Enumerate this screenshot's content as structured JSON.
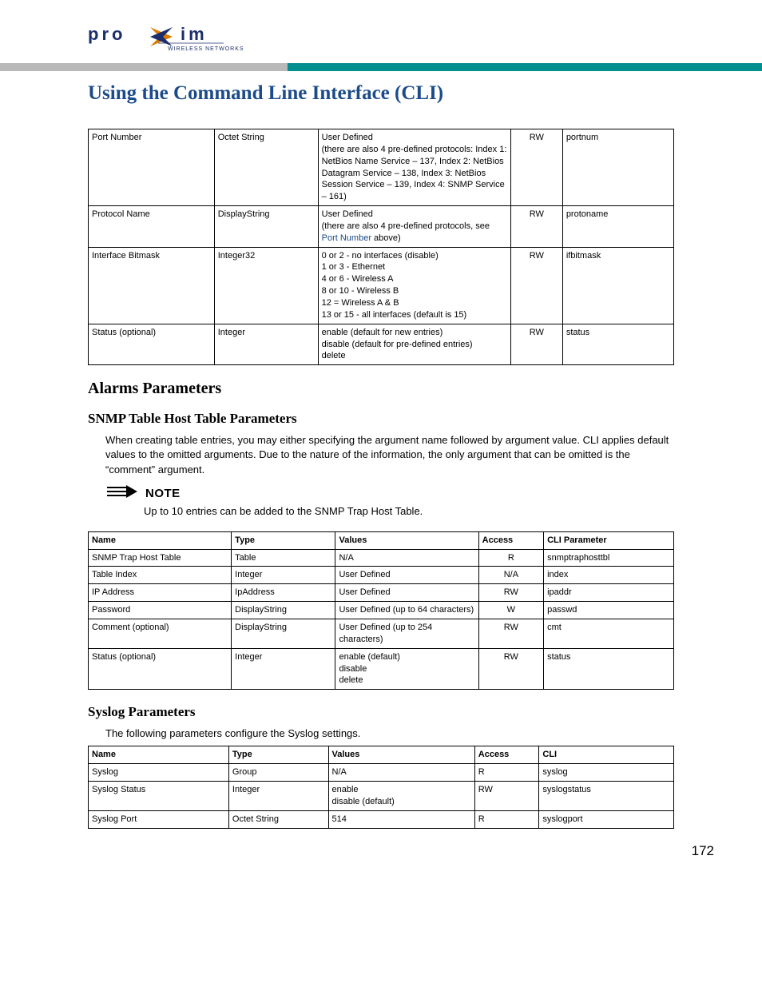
{
  "brand": {
    "name": "proxim",
    "tagline": "WIRELESS NETWORKS"
  },
  "title": "Using the Command Line Interface (CLI)",
  "table1": {
    "rows": [
      {
        "name": "Port Number",
        "type": "Octet String",
        "values": "User Defined\n(there are also 4 pre-defined protocols: Index 1: NetBios Name Service – 137, Index 2: NetBios Datagram Service – 138, Index 3: NetBios Session Service – 139, Index 4: SNMP Service – 161)",
        "access": "RW",
        "cli": "portnum"
      },
      {
        "name": "Protocol Name",
        "type": "DisplayString",
        "values_pre": "User Defined\n(there are also 4 pre-defined protocols, see ",
        "values_link": "Port Number",
        "values_post": " above)",
        "access": "RW",
        "cli": "protoname"
      },
      {
        "name": "Interface Bitmask",
        "type": "Integer32",
        "values": "0 or 2 - no interfaces (disable)\n1 or 3 - Ethernet\n4 or 6 - Wireless A\n8 or 10 - Wireless B\n12 = Wireless A & B\n13 or 15 - all interfaces (default is 15)",
        "access": "RW",
        "cli": "ifbitmask"
      },
      {
        "name": "Status (optional)",
        "type": "Integer",
        "values": "enable (default for new entries)\ndisable (default for pre-defined entries)\ndelete",
        "access": "RW",
        "cli": "status"
      }
    ]
  },
  "section_alarms": "Alarms Parameters",
  "section_snmp": "SNMP Table Host Table Parameters",
  "snmp_intro": "When creating table entries, you may either specifying the argument name followed by argument value. CLI applies default values to the omitted arguments. Due to the nature of the information, the only argument that can be omitted is the “comment” argument.",
  "note_label": "NOTE",
  "note_text": "Up to 10 entries can be added to the SNMP Trap Host Table.",
  "table2": {
    "headers": [
      "Name",
      "Type",
      "Values",
      "Access",
      "CLI Parameter"
    ],
    "rows": [
      {
        "name": "SNMP Trap Host Table",
        "type": "Table",
        "values": "N/A",
        "access": "R",
        "cli": "snmptraphosttbl"
      },
      {
        "name": "Table Index",
        "type": "Integer",
        "values": "User Defined",
        "access": "N/A",
        "cli": "index"
      },
      {
        "name": "IP Address",
        "type": "IpAddress",
        "values": "User Defined",
        "access": "RW",
        "cli": "ipaddr"
      },
      {
        "name": "Password",
        "type": "DisplayString",
        "values": "User Defined (up to 64 characters)",
        "access": "W",
        "cli": "passwd"
      },
      {
        "name": "Comment (optional)",
        "type": "DisplayString",
        "values": "User Defined (up to 254 characters)",
        "access": "RW",
        "cli": "cmt"
      },
      {
        "name": "Status (optional)",
        "type": "Integer",
        "values": "enable (default)\ndisable\ndelete",
        "access": "RW",
        "cli": "status"
      }
    ]
  },
  "section_syslog": "Syslog Parameters",
  "syslog_intro": "The following parameters configure the Syslog settings.",
  "table3": {
    "headers": [
      "Name",
      "Type",
      "Values",
      "Access",
      "CLI"
    ],
    "rows": [
      {
        "name": "Syslog",
        "type": "Group",
        "values": "N/A",
        "access": "R",
        "cli": "syslog"
      },
      {
        "name": "Syslog Status",
        "type": "Integer",
        "values": "enable\ndisable (default)",
        "access": "RW",
        "cli": "syslogstatus"
      },
      {
        "name": "Syslog Port",
        "type": "Octet String",
        "values": "514",
        "access": "R",
        "cli": "syslogport"
      }
    ]
  },
  "page_number": "172"
}
